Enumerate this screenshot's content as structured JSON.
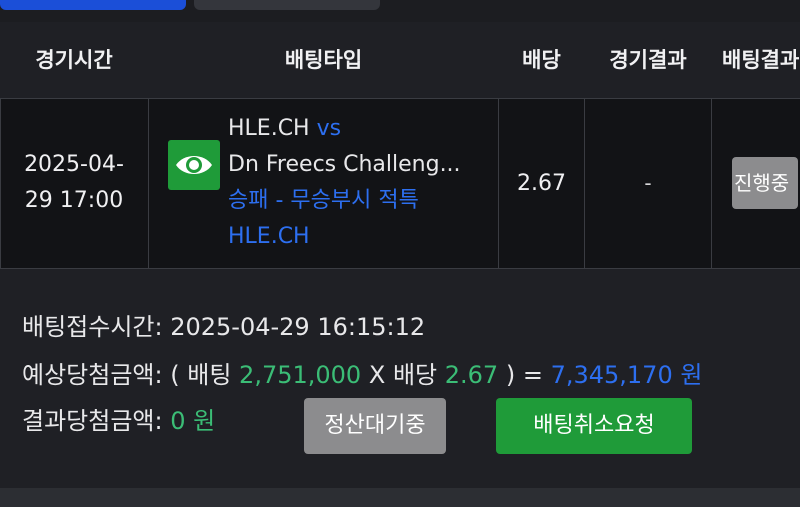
{
  "header": {
    "col_time": "경기시간",
    "col_type": "배팅타입",
    "col_odds": "배당",
    "col_result": "경기결과",
    "col_bet_result": "배팅결과"
  },
  "row": {
    "time_line1": "2025-04-",
    "time_line2": "29 17:00",
    "team_home": "HLE.CH",
    "vs": "vs",
    "team_away": "Dn Freecs Challeng...",
    "bet_type": "승패 - 무승부시 적특",
    "pick": "HLE.CH",
    "odds": "2.67",
    "game_result": "-",
    "status": "진행중"
  },
  "summary": {
    "bet_time_label": "배팅접수시간:",
    "bet_time_value": "2025-04-29 16:15:12",
    "expected_label": "예상당첨금액:",
    "open_paren": "(",
    "bet_word": "배팅",
    "bet_amount": "2,751,000",
    "times": "X",
    "odds_word": "배당",
    "odds_value": "2.67",
    "close_eq": ") =",
    "expected_amount": "7,345,170 원",
    "result_label": "결과당첨금액:",
    "result_amount": "0 원"
  },
  "buttons": {
    "pending": "정산대기중",
    "cancel": "배팅취소요청"
  },
  "colors": {
    "accent_blue": "#2d6ff0",
    "green": "#3bbd76",
    "button_green": "#1f9b39",
    "button_gray": "#8c8c8e"
  },
  "icons": {
    "eye": "eye-icon"
  }
}
